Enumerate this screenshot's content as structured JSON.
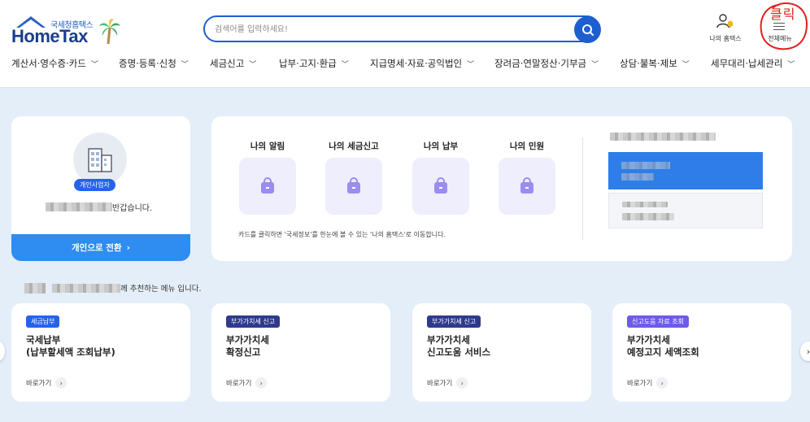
{
  "header": {
    "logo_small": "국세청홈택스",
    "logo_main": "HomeTax",
    "search_placeholder": "검색어를 입력하세요!",
    "my_hometax_label": "나의 홈택스",
    "all_menu_label": "전체메뉴",
    "annotation_text": "클릭"
  },
  "nav": {
    "items": [
      {
        "label": "계산서·영수증·카드"
      },
      {
        "label": "증명·등록·신청"
      },
      {
        "label": "세금신고"
      },
      {
        "label": "납부·고지·환급"
      },
      {
        "label": "지급명세·자료·공익법인"
      },
      {
        "label": "장려금·연말정산·기부금"
      },
      {
        "label": "상담·불복·제보"
      },
      {
        "label": "세무대리·납세관리"
      }
    ]
  },
  "profile": {
    "badge": "개인사업자",
    "greeting": "반갑습니다.",
    "switch_label": "개인으로 전환"
  },
  "summary": {
    "items": [
      {
        "label": "나의 알림"
      },
      {
        "label": "나의 세금신고"
      },
      {
        "label": "나의 납부"
      },
      {
        "label": "나의 민원"
      }
    ],
    "note": "카드를 클릭하면 '국세정보'를 한눈에 볼 수 있는 '나의 홈택스'로 이동합니다."
  },
  "recommend": {
    "text": "께 추천하는 메뉴 입니다."
  },
  "cards": [
    {
      "tag": "세금납부",
      "tag_color": "#2563eb",
      "title": "국세납부\n(납부할세액 조회납부)",
      "link": "바로가기"
    },
    {
      "tag": "부가가치세 신고",
      "tag_color": "#2e3a8c",
      "title": "부가가치세\n확정신고",
      "link": "바로가기"
    },
    {
      "tag": "부가가치세 신고",
      "tag_color": "#2e3a8c",
      "title": "부가가치세\n신고도움 서비스",
      "link": "바로가기"
    },
    {
      "tag": "신고도움 자료 조회",
      "tag_color": "#6d5ce8",
      "title": "부가가치세\n예정고지 세액조회",
      "link": "바로가기"
    }
  ],
  "colors": {
    "primary": "#1d5fd0",
    "page_bg": "#e4eef8",
    "annotation": "#e0201f"
  }
}
